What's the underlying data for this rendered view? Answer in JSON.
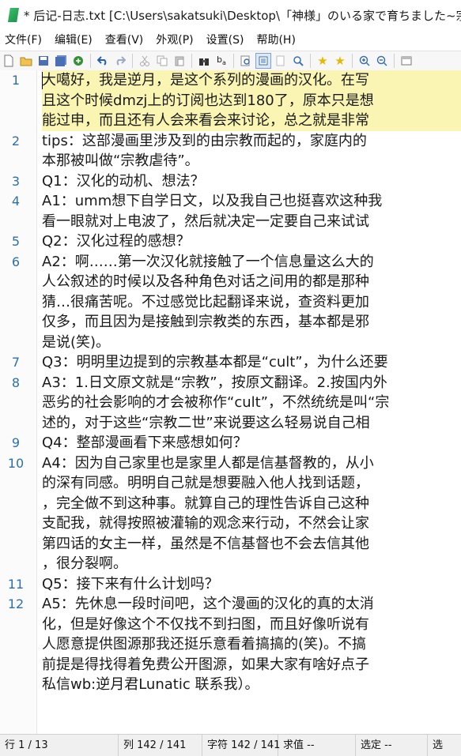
{
  "window": {
    "title": "* 后记-日志.txt [C:\\Users\\sakatsuki\\Desktop\\「神様」のいる家で育ちました~宗"
  },
  "menu": [
    "文件(F)",
    "编辑(E)",
    "查看(V)",
    "外观(P)",
    "设置(S)",
    "帮助(H)"
  ],
  "toolbar_icons": [
    "new-icon",
    "open-icon",
    "save-icon",
    "save-all-icon",
    "reload-icon",
    "undo-icon",
    "redo-icon",
    "cut-icon",
    "copy-icon",
    "paste-icon",
    "find-icon",
    "replace-icon",
    "find-in-files-icon",
    "view-icon",
    "copy-path-icon",
    "zoom-icon",
    "bookmark-icon",
    "bookmark-next-icon",
    "zoom-in-icon",
    "zoom-out-icon",
    "window-icon"
  ],
  "editor": {
    "lines": [
      {
        "num": "1",
        "current": true,
        "text": [
          "大噶好，我是逆月，是这个系列的漫画的汉化。在写",
          "且这个时候dmzj上的订阅也达到180了，原本只是想",
          "能过申，而且还有人会来看会来讨论，总之就是非常"
        ]
      },
      {
        "num": "2",
        "text": [
          "tips：这部漫画里涉及到的由宗教而起的，家庭内的",
          "本那被叫做“宗教虐待”。"
        ]
      },
      {
        "num": "3",
        "text": [
          "Q1：汉化的动机、想法？"
        ]
      },
      {
        "num": "4",
        "text": [
          "A1：umm想下自学日文，以及我自己也挺喜欢这种我",
          "看一眼就对上电波了，然后就决定一定要自己来试试"
        ]
      },
      {
        "num": "5",
        "text": [
          "Q2：汉化过程的感想？"
        ]
      },
      {
        "num": "6",
        "text": [
          "A2：啊……第一次汉化就接触了一个信息量这么大的",
          "人公叙述的时候以及各种角色对话之间用的都是那种",
          "猜…很痛苦呢。不过感觉比起翻译来说，查资料更加",
          "仅多，而且因为是接触到宗教类的东西，基本都是邪",
          "是说(笑)。"
        ]
      },
      {
        "num": "7",
        "text": [
          "Q3：明明里边提到的宗教基本都是“cult”，为什么还要"
        ]
      },
      {
        "num": "8",
        "text": [
          "A3：1.日文原文就是“宗教”，按原文翻译。2.按国内外",
          "恶劣的社会影响的才会被称作“cult”，不然统统是叫“宗",
          "述的，对于这些“宗教二世”来说要这么轻易说自己相"
        ]
      },
      {
        "num": "9",
        "text": [
          "Q4：整部漫画看下来感想如何？"
        ]
      },
      {
        "num": "10",
        "text": [
          "A4：因为自己家里也是家里人都是信基督教的，从小",
          "的深有同感。明明自己就是想要融入他人找到话题，",
          "，完全做不到这种事。就算自己的理性告诉自己这种",
          "支配我，就得按照被灌输的观念来行动，不然会让家",
          "第四话的女主一样，虽然是不信基督也不会去信其他",
          "，很分裂啊。"
        ]
      },
      {
        "num": "11",
        "text": [
          "Q5：接下来有什么计划吗？"
        ]
      },
      {
        "num": "12",
        "text": [
          "A5：先休息一段时间吧，这个漫画的汉化的真的太消",
          "化，但是好像这个不仅找不到扫图，而且好像听说有",
          "人愿意提供图源那我还挺乐意看着搞搞的(笑)。不搞",
          "前提是得找得着免费公开图源，如果大家有啥好点子",
          "私信wb:逆月君Lunatic 联系我）。"
        ]
      }
    ]
  },
  "statusbar": {
    "line": "行 1 / 13",
    "col": "列 142 / 141",
    "char": "字符 142 / 141",
    "value": "求值 --",
    "selection": "选定 --",
    "sel2": "选"
  }
}
